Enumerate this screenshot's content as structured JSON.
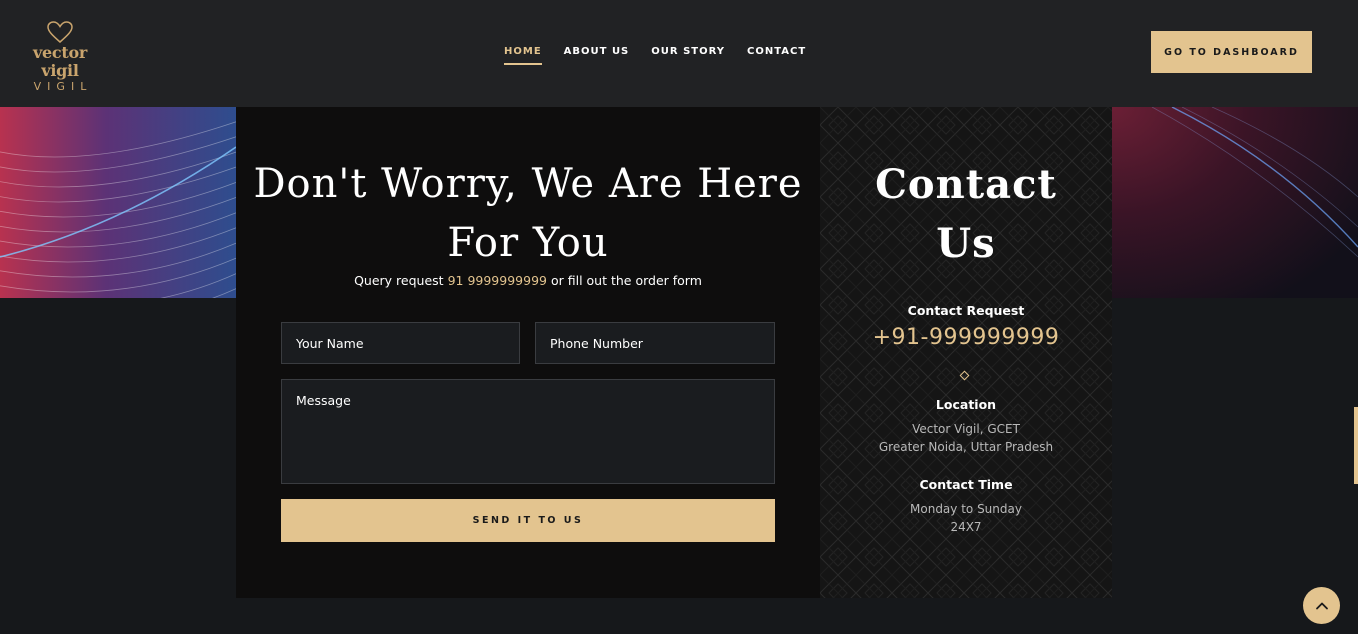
{
  "brand": {
    "name": "vector vigil",
    "sub": "VIGIL",
    "accent_color": "#e3c48f",
    "icon": "heart-outline-icon"
  },
  "nav": {
    "items": [
      {
        "label": "HOME",
        "active": true
      },
      {
        "label": "ABOUT US",
        "active": false
      },
      {
        "label": "OUR STORY",
        "active": false
      },
      {
        "label": "CONTACT",
        "active": false
      }
    ],
    "dashboard_label": "GO TO DASHBOARD"
  },
  "form": {
    "headline_line1": "Don't Worry, We Are Here",
    "headline_line2": "For You",
    "query_prefix": "Query request",
    "query_phone": "91 9999999999",
    "query_suffix": "or fill out the order form",
    "name_placeholder": "Your Name",
    "phone_placeholder": "Phone Number",
    "message_placeholder": "Message",
    "submit_label": "SEND IT TO US"
  },
  "contact": {
    "title_line1": "Contact",
    "title_line2": "Us",
    "request_label": "Contact Request",
    "phone": "+91-999999999",
    "location_label": "Location",
    "location_line1": "Vector Vigil, GCET",
    "location_line2": "Greater Noida, Uttar Pradesh",
    "time_label": "Contact Time",
    "time_line1": "Monday to Sunday",
    "time_line2": "24X7"
  },
  "scroll_top_icon": "chevron-up-icon"
}
